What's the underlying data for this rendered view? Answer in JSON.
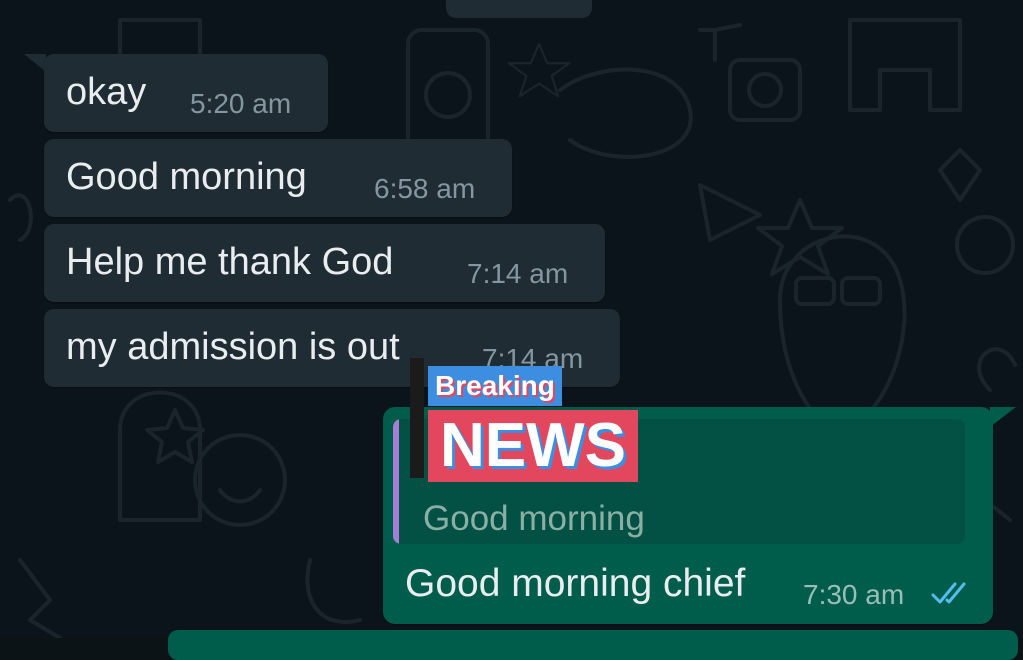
{
  "messages_in": [
    {
      "text": "okay",
      "time": "5:20 am"
    },
    {
      "text": "Good morning",
      "time": "6:58 am"
    },
    {
      "text": "Help me thank God",
      "time": "7:14 am"
    },
    {
      "text": "my admission is out",
      "time": "7:14 am"
    }
  ],
  "message_out": {
    "quoted_text": "Good morning",
    "text": "Good morning chief",
    "time": "7:30 am",
    "status_icon": "double-check-read-icon"
  },
  "overlay": {
    "line1": "Breaking",
    "line2": "NEWS"
  },
  "colors": {
    "background": "#0b141a",
    "incoming_bubble": "#1f2c33",
    "outgoing_bubble": "#005c4b",
    "read_ticks": "#53bdeb",
    "breaking_blue": "#3d8ee0",
    "news_red": "#e2475e"
  }
}
